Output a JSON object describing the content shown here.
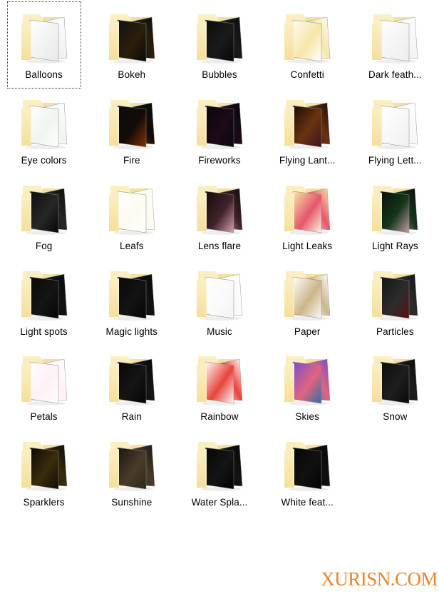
{
  "view": {
    "type": "icon-grid",
    "columns": 5,
    "rows": 7,
    "background_color": "#ffffff",
    "label_color": "#000000",
    "folder_color": "#F5DF9B",
    "folder_shadow_color": "#E2C882"
  },
  "watermark": {
    "text": "XURISN.COM",
    "color": "#E8862A"
  },
  "items": [
    {
      "label": "Balloons",
      "focused": true,
      "preview": {
        "name": "balloons-preview",
        "kind": "light",
        "c1": "#ffffff",
        "c2": "#f2f2f2",
        "c3": "#e9e9e9"
      }
    },
    {
      "label": "Bokeh",
      "focused": false,
      "preview": {
        "name": "bokeh-preview",
        "kind": "dark",
        "c1": "#111010",
        "c2": "#2b1f0c",
        "c3": "#0a0a0a"
      }
    },
    {
      "label": "Bubbles",
      "focused": false,
      "preview": {
        "name": "bubbles-preview",
        "kind": "dark",
        "c1": "#0c0c0c",
        "c2": "#1a1a1a",
        "c3": "#070707"
      }
    },
    {
      "label": "Confetti",
      "focused": false,
      "preview": {
        "name": "confetti-preview",
        "kind": "light",
        "c1": "#fdfbf3",
        "c2": "#f6e7a8",
        "c3": "#ffffff"
      }
    },
    {
      "label": "Dark feath...",
      "focused": false,
      "preview": {
        "name": "dark-feathers-preview",
        "kind": "light",
        "c1": "#ffffff",
        "c2": "#f4f4f4",
        "c3": "#ededed"
      }
    },
    {
      "label": "Eye colors",
      "focused": false,
      "preview": {
        "name": "eye-colors-preview",
        "kind": "light",
        "c1": "#ffffff",
        "c2": "#f0f5ef",
        "c3": "#ffffff"
      }
    },
    {
      "label": "Fire",
      "focused": false,
      "preview": {
        "name": "fire-preview",
        "kind": "dark",
        "c1": "#0b0b0b",
        "c2": "#120c08",
        "c3": "#8d2f06"
      }
    },
    {
      "label": "Fireworks",
      "focused": false,
      "preview": {
        "name": "fireworks-preview",
        "kind": "dark",
        "c1": "#09060e",
        "c2": "#1b0b16",
        "c3": "#0b0713"
      }
    },
    {
      "label": "Flying Lant...",
      "focused": false,
      "preview": {
        "name": "flying-lanterns-preview",
        "kind": "dark",
        "c1": "#1a0c06",
        "c2": "#6b3310",
        "c3": "#3b1320"
      }
    },
    {
      "label": "Flying Lett...",
      "focused": false,
      "preview": {
        "name": "flying-letters-preview",
        "kind": "light",
        "c1": "#ffffff",
        "c2": "#f7f7f7",
        "c3": "#f0f0f0"
      }
    },
    {
      "label": "Fog",
      "focused": false,
      "preview": {
        "name": "fog-preview",
        "kind": "dark",
        "c1": "#0d0d0d",
        "c2": "#272727",
        "c3": "#070707"
      }
    },
    {
      "label": "Leafs",
      "focused": false,
      "preview": {
        "name": "leafs-preview",
        "kind": "light",
        "c1": "#ffffff",
        "c2": "#fdfaf0",
        "c3": "#ffffff"
      }
    },
    {
      "label": "Lens flare",
      "focused": false,
      "preview": {
        "name": "lens-flare-preview",
        "kind": "dark",
        "c1": "#120b0b",
        "c2": "#40222a",
        "c3": "#d8a3ad"
      }
    },
    {
      "label": "Light Leaks",
      "focused": false,
      "preview": {
        "name": "light-leaks-preview",
        "kind": "light",
        "c1": "#f7e9a8",
        "c2": "#e5566c",
        "c3": "#fbf6e0"
      }
    },
    {
      "label": "Light Rays",
      "focused": false,
      "preview": {
        "name": "light-rays-preview",
        "kind": "dark",
        "c1": "#0a0f0a",
        "c2": "#14361c",
        "c3": "#c99aa6"
      }
    },
    {
      "label": "Light spots",
      "focused": false,
      "preview": {
        "name": "light-spots-preview",
        "kind": "dark",
        "c1": "#0a0a0a",
        "c2": "#141414",
        "c3": "#060606"
      }
    },
    {
      "label": "Magic lights",
      "focused": false,
      "preview": {
        "name": "magic-lights-preview",
        "kind": "dark",
        "c1": "#090909",
        "c2": "#131313",
        "c3": "#050505"
      }
    },
    {
      "label": "Music",
      "focused": false,
      "preview": {
        "name": "music-preview",
        "kind": "light",
        "c1": "#ffffff",
        "c2": "#fafafa",
        "c3": "#f3f3f3"
      }
    },
    {
      "label": "Paper",
      "focused": false,
      "preview": {
        "name": "paper-preview",
        "kind": "light",
        "c1": "#ffffff",
        "c2": "#cbb68a",
        "c3": "#fbfbfb"
      }
    },
    {
      "label": "Particles",
      "focused": false,
      "preview": {
        "name": "particles-preview",
        "kind": "dark",
        "c1": "#141414",
        "c2": "#2c2c2c",
        "c3": "#5c0f14"
      }
    },
    {
      "label": "Petals",
      "focused": false,
      "preview": {
        "name": "petals-preview",
        "kind": "light",
        "c1": "#ffffff",
        "c2": "#fdf1f4",
        "c3": "#ffffff"
      }
    },
    {
      "label": "Rain",
      "focused": false,
      "preview": {
        "name": "rain-preview",
        "kind": "dark",
        "c1": "#080808",
        "c2": "#151515",
        "c3": "#040404"
      }
    },
    {
      "label": "Rainbow",
      "focused": false,
      "preview": {
        "name": "rainbow-preview",
        "kind": "light",
        "c1": "#ffffff",
        "c2": "#e8443a",
        "c3": "#fcfcfc"
      }
    },
    {
      "label": "Skies",
      "focused": false,
      "preview": {
        "name": "skies-preview",
        "kind": "color",
        "c1": "#7a4ad0",
        "c2": "#e0657f",
        "c3": "#2f6fa8"
      }
    },
    {
      "label": "Snow",
      "focused": false,
      "preview": {
        "name": "snow-preview",
        "kind": "dark",
        "c1": "#0c0c0c",
        "c2": "#1e1e1e",
        "c3": "#080808"
      }
    },
    {
      "label": "Sparklers",
      "focused": false,
      "preview": {
        "name": "sparklers-preview",
        "kind": "dark",
        "c1": "#0a0905",
        "c2": "#3a2d0c",
        "c3": "#100d06"
      }
    },
    {
      "label": "Sunshine",
      "focused": false,
      "preview": {
        "name": "sunshine-preview",
        "kind": "dark",
        "c1": "#1a1512",
        "c2": "#4a3b2a",
        "c3": "#2b2a17"
      }
    },
    {
      "label": "Water Spla...",
      "focused": false,
      "preview": {
        "name": "water-splash-preview",
        "kind": "dark",
        "c1": "#070707",
        "c2": "#141414",
        "c3": "#030303"
      }
    },
    {
      "label": "White feat...",
      "focused": false,
      "preview": {
        "name": "white-feathers-preview",
        "kind": "dark",
        "c1": "#060606",
        "c2": "#111111",
        "c3": "#020202"
      }
    }
  ]
}
